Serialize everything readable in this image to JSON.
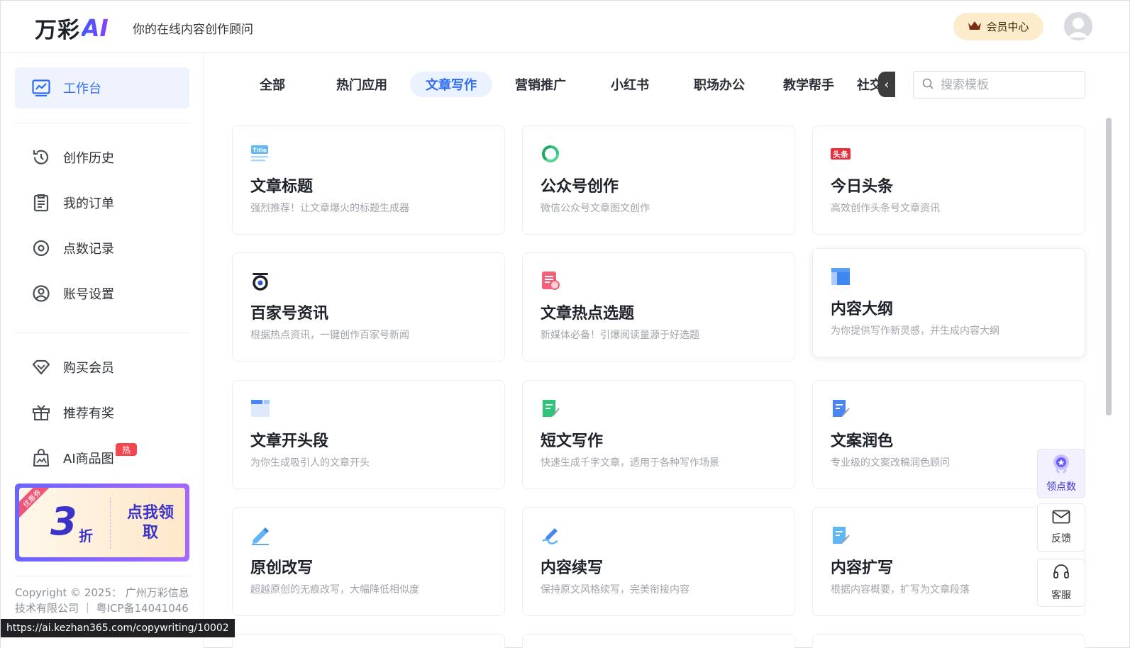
{
  "header": {
    "logo_cn": "万彩",
    "logo_ai": "AI",
    "tagline": "你的在线内容创作顾问",
    "vip_label": "会员中心"
  },
  "sidebar": {
    "items": [
      {
        "label": "工作台",
        "icon": "chart-monitor-icon"
      },
      {
        "label": "创作历史",
        "icon": "history-icon"
      },
      {
        "label": "我的订单",
        "icon": "order-clipboard-icon"
      },
      {
        "label": "点数记录",
        "icon": "points-record-icon"
      },
      {
        "label": "账号设置",
        "icon": "user-settings-icon"
      },
      {
        "label": "购买会员",
        "icon": "diamond-icon"
      },
      {
        "label": "推荐有奖",
        "icon": "gift-icon"
      },
      {
        "label": "AI商品图",
        "icon": "product-image-icon"
      }
    ],
    "hot_badge": "热",
    "promo": {
      "corner": "优惠券",
      "number": "3",
      "unit": "折",
      "cta": "点我领取"
    },
    "copyright": "Copyright © 2025： 广州万彩信息技术有限公司 ｜ 粤ICP备14041046"
  },
  "tabs": {
    "items": [
      "全部",
      "热门应用",
      "文章写作",
      "营销推广",
      "小红书",
      "职场办公",
      "教学帮手",
      "社交"
    ],
    "active": "文章写作"
  },
  "search": {
    "placeholder": "搜索模板"
  },
  "cards": [
    {
      "title": "文章标题",
      "desc": "强烈推荐！让文章爆火的标题生成器",
      "icon": "title-icon"
    },
    {
      "title": "公众号创作",
      "desc": "微信公众号文章图文创作",
      "icon": "wechat-official-icon"
    },
    {
      "title": "今日头条",
      "desc": "高效创作头条号文章资讯",
      "icon": "toutiao-icon"
    },
    {
      "title": "百家号资讯",
      "desc": "根据热点资讯，一键创作百家号新闻",
      "icon": "baijiahao-icon"
    },
    {
      "title": "文章热点选题",
      "desc": "新媒体必备！引爆阅读量源于好选题",
      "icon": "hot-topic-icon"
    },
    {
      "title": "内容大纲",
      "desc": "为你提供写作新灵感，并生成内容大纲",
      "icon": "outline-icon"
    },
    {
      "title": "文章开头段",
      "desc": "为你生成吸引人的文章开头",
      "icon": "opening-paragraph-icon"
    },
    {
      "title": "短文写作",
      "desc": "快速生成千字文章，适用于各种写作场景",
      "icon": "short-writing-icon"
    },
    {
      "title": "文案润色",
      "desc": "专业级的文案改稿润色顾问",
      "icon": "polish-icon"
    },
    {
      "title": "原创改写",
      "desc": "超越原创的无痕改写，大幅降低相似度",
      "icon": "rewrite-pen-icon"
    },
    {
      "title": "内容续写",
      "desc": "保持原文风格续写，完美衔接内容",
      "icon": "continue-writing-icon"
    },
    {
      "title": "内容扩写",
      "desc": "根据内容概要，扩写为文章段落",
      "icon": "expand-writing-icon"
    }
  ],
  "float": {
    "points": "领点数",
    "feedback": "反馈",
    "service": "客服"
  },
  "status_url": "https://ai.kezhan365.com/copywriting/10002",
  "colors": {
    "accent": "#2f6cf6",
    "hot": "#f5454f",
    "promo": "#3b33c9"
  }
}
